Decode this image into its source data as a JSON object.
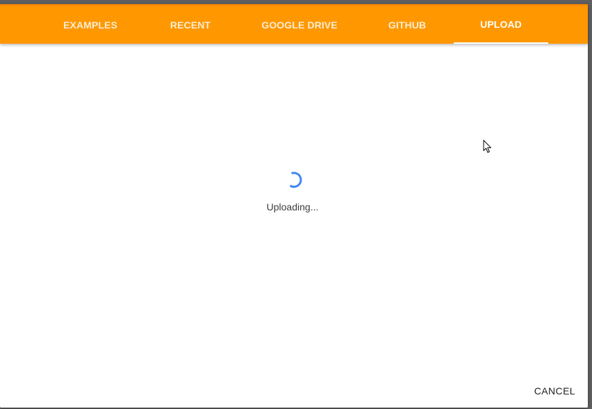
{
  "tabs": [
    {
      "label": "EXAMPLES"
    },
    {
      "label": "RECENT"
    },
    {
      "label": "GOOGLE DRIVE"
    },
    {
      "label": "GITHUB"
    },
    {
      "label": "UPLOAD"
    }
  ],
  "active_tab": "UPLOAD",
  "status": {
    "text": "Uploading..."
  },
  "footer": {
    "cancel_label": "CANCEL"
  },
  "colors": {
    "accent": "#ff9800",
    "spinner": "#4285f4"
  },
  "icons": {
    "spinner": "loading-spinner-icon",
    "cursor": "mouse-pointer-icon"
  }
}
